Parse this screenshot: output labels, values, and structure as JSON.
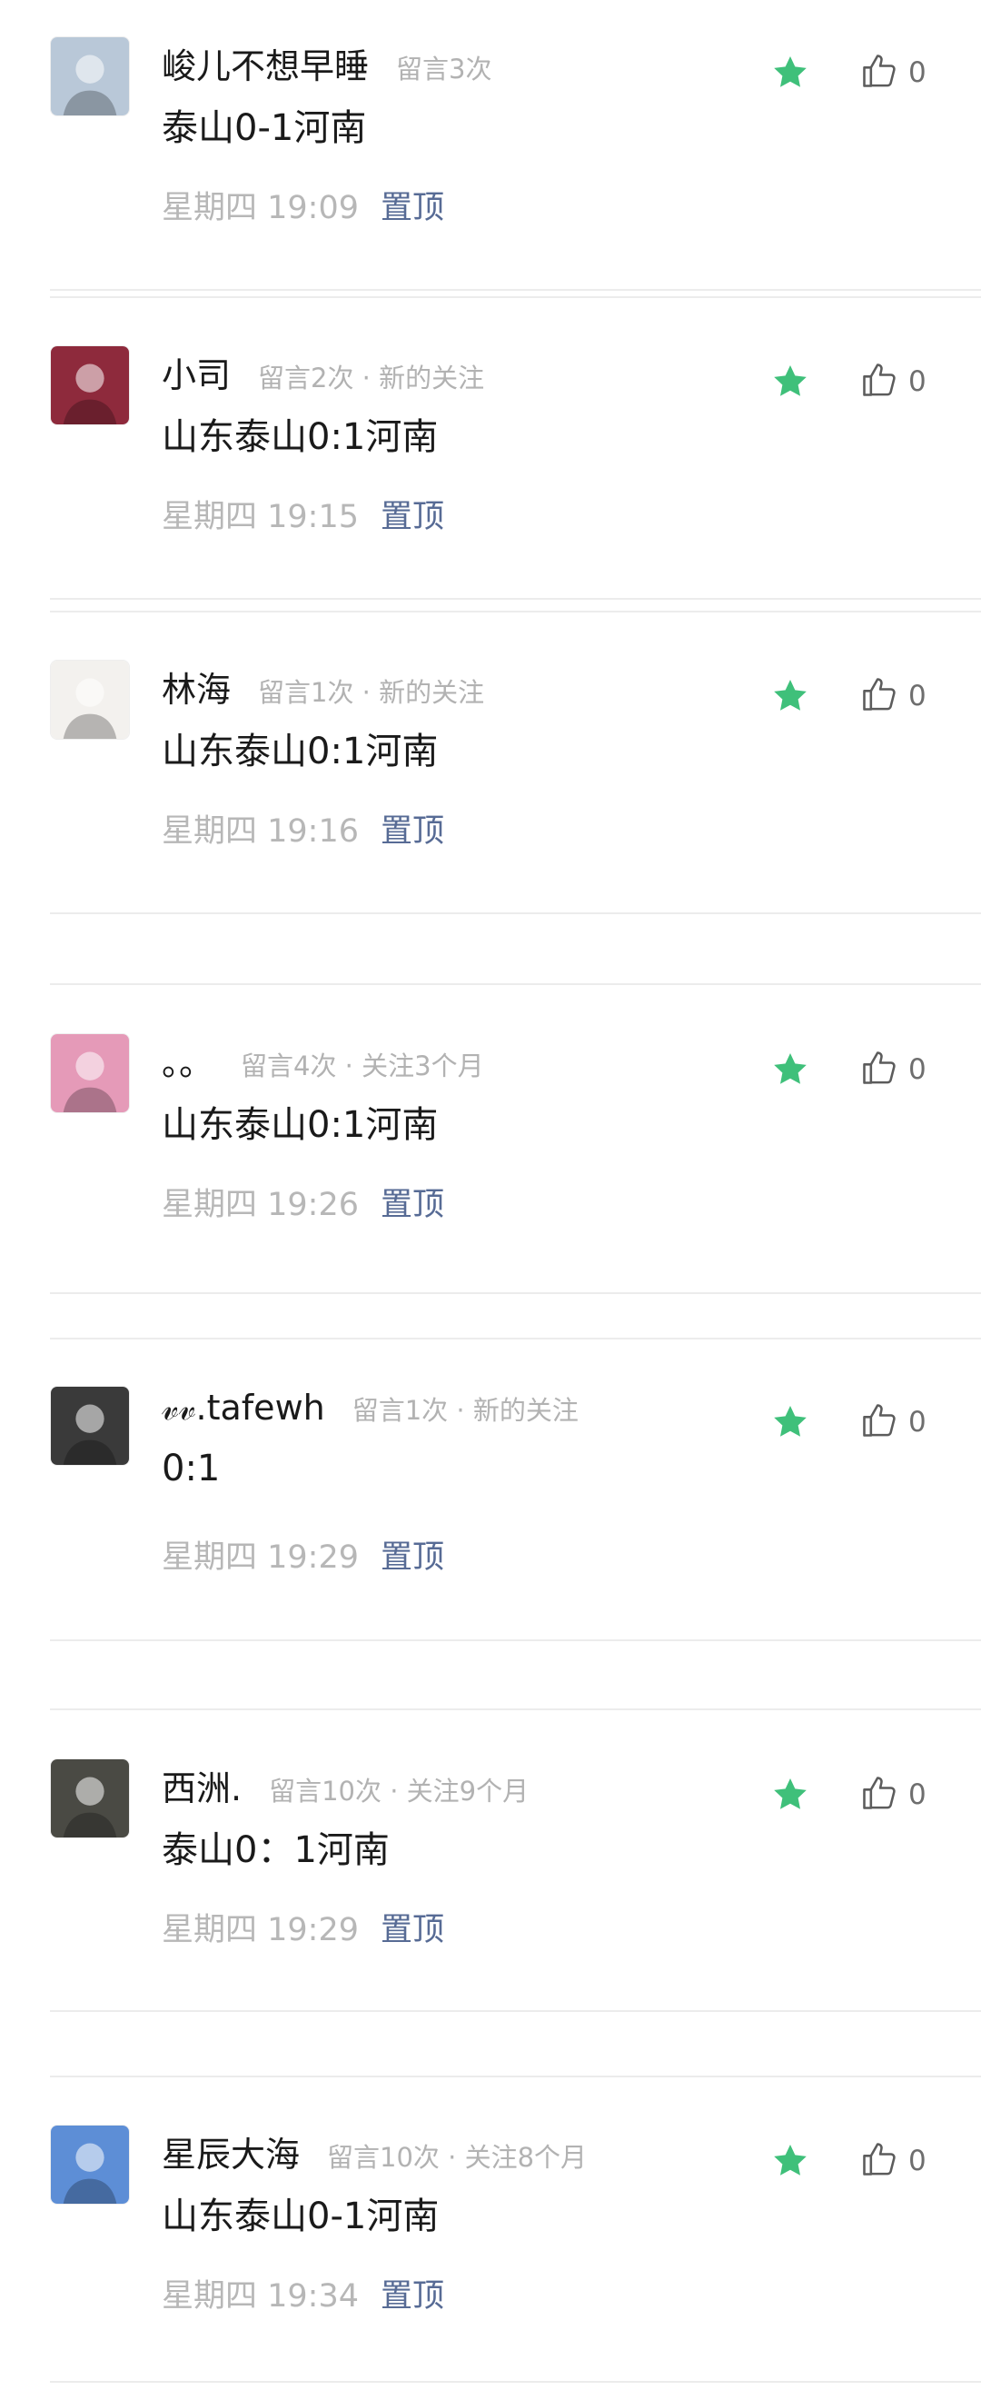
{
  "comments": [
    {
      "name": "峻儿不想早睡",
      "meta": "留言3次",
      "content": "泰山0-1河南",
      "time": "星期四  19:09",
      "pin": "置顶",
      "likes": "0",
      "avatar_color": "#b9c8d8"
    },
    {
      "name": "小司",
      "meta": "留言2次 · 新的关注",
      "content": "山东泰山0:1河南",
      "time": "星期四  19:15",
      "pin": "置顶",
      "likes": "0",
      "avatar_color": "#8e2a3c"
    },
    {
      "name": "林海",
      "meta": "留言1次 · 新的关注",
      "content": "山东泰山0:1河南",
      "time": "星期四  19:16",
      "pin": "置顶",
      "likes": "0",
      "avatar_color": "#f3f1ee"
    },
    {
      "name": "。。",
      "meta": "留言4次 · 关注3个月",
      "content": "山东泰山0:1河南",
      "time": "星期四  19:26",
      "pin": "置顶",
      "likes": "0",
      "avatar_color": "#e59ab8"
    },
    {
      "name": "𝓋𝓋.tafewh",
      "meta": "留言1次 · 新的关注",
      "content": "0:1",
      "time": "星期四  19:29",
      "pin": "置顶",
      "likes": "0",
      "avatar_color": "#3a3a3a"
    },
    {
      "name": "西洲.",
      "meta": "留言10次 · 关注9个月",
      "content": "泰山0：1河南",
      "time": "星期四  19:29",
      "pin": "置顶",
      "likes": "0",
      "avatar_color": "#4a4a44"
    },
    {
      "name": "星辰大海",
      "meta": "留言10次 · 关注8个月",
      "content": "山东泰山0-1河南",
      "time": "星期四  19:34",
      "pin": "置顶",
      "likes": "0",
      "avatar_color": "#5d8ed6"
    }
  ],
  "colors": {
    "star": "#3fc07a",
    "pin_link": "#576b95",
    "muted": "#b2b2b2"
  },
  "icons": {
    "star": "star-icon",
    "like": "thumbs-up-icon"
  }
}
